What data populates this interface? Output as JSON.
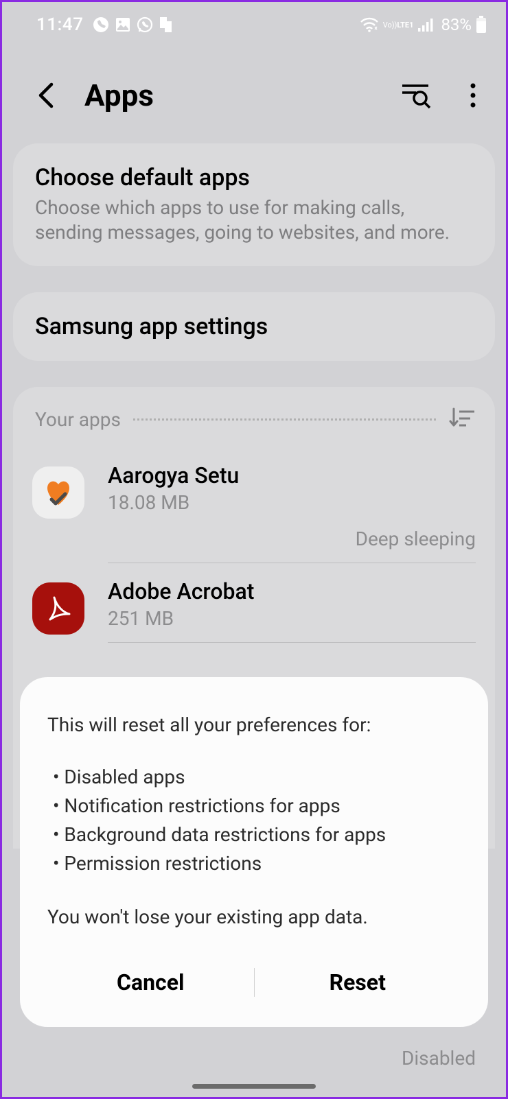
{
  "status": {
    "time": "11:47",
    "battery": "83%",
    "network_label": "LTE1",
    "volte_label": "Vo))"
  },
  "header": {
    "title": "Apps"
  },
  "cards": {
    "default_apps": {
      "title": "Choose default apps",
      "subtitle": "Choose which apps to use for making calls, sending messages, going to websites, and more."
    },
    "samsung": {
      "title": "Samsung app settings"
    }
  },
  "your_apps": {
    "label": "Your apps",
    "items": [
      {
        "name": "Aarogya Setu",
        "size": "18.08 MB",
        "status": "Deep sleeping"
      },
      {
        "name": "Adobe Acrobat",
        "size": "251 MB",
        "status": ""
      }
    ]
  },
  "dialog": {
    "intro": "This will reset all your preferences for:",
    "bullets": [
      "Disabled apps",
      "Notification restrictions for apps",
      "Background data restrictions for apps",
      "Permission restrictions"
    ],
    "footnote": "You won't lose your existing app data.",
    "cancel": "Cancel",
    "reset": "Reset"
  },
  "bottom_hint": "Disabled"
}
